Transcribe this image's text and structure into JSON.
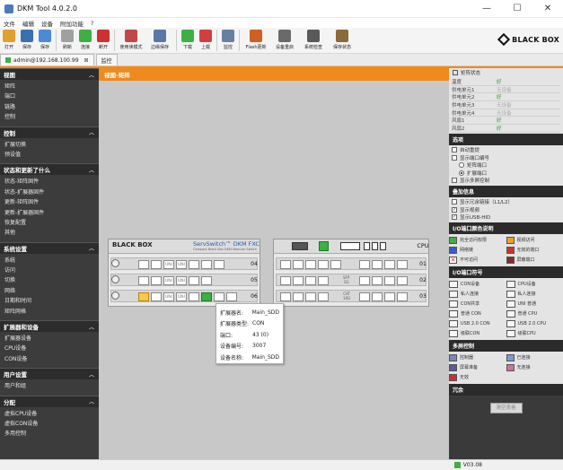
{
  "window": {
    "title": "DKM Tool 4.0.2.0",
    "minimize": "—",
    "maximize": "☐",
    "close": "✕"
  },
  "menu": [
    "文件",
    "编辑",
    "设备",
    "附加功能",
    "?"
  ],
  "toolbar": [
    {
      "label": "打开",
      "color": "#e0a030"
    },
    {
      "label": "保存",
      "color": "#3a6fb0"
    },
    {
      "label": "保存",
      "color": "#4a8ad8"
    },
    {
      "label": "刷新",
      "color": "#a0a0a0"
    },
    {
      "label": "连接",
      "color": "#3cb043"
    },
    {
      "label": "断开",
      "color": "#d03030"
    },
    {
      "label": "使用读模式",
      "color": "#c04848"
    },
    {
      "label": "边缘保存",
      "color": "#5878a8"
    },
    {
      "label": "下载",
      "color": "#3cb043"
    },
    {
      "label": "上载",
      "color": "#d04040"
    },
    {
      "label": "监控",
      "color": "#6880a0"
    },
    {
      "label": "Flash更新",
      "color": "#d06020"
    },
    {
      "label": "设备重启",
      "color": "#6a6a6a"
    },
    {
      "label": "系统检查",
      "color": "#5a5a5a"
    },
    {
      "label": "保存状态",
      "color": "#8a6a3a"
    }
  ],
  "brand": "BLACK BOX",
  "tabs": [
    {
      "label": "admin@192.168.100.99",
      "close": "⊠"
    },
    {
      "label": "监控"
    }
  ],
  "sidebar": {
    "sections": [
      {
        "title": "视图",
        "items": [
          "矩阵",
          "端口",
          "链路",
          "控制"
        ]
      },
      {
        "title": "控制",
        "items": [
          "扩展切换",
          "预设值"
        ]
      },
      {
        "title": "状态和更新了什么",
        "items": [
          "状态-矩阵固件",
          "状态-扩展器固件",
          "更新-矩阵固件",
          "更新-扩展器固件",
          "恢复配置",
          "其他"
        ]
      },
      {
        "title": "系统设置",
        "items": [
          "系统",
          "访问",
          "切换",
          "网络",
          "日期和时间",
          "矩阵网格"
        ]
      },
      {
        "title": "扩展器和设备",
        "items": [
          "扩展器设备",
          "CPU设备",
          "CON设备"
        ]
      },
      {
        "title": "用户设置",
        "items": [
          "用户和组"
        ]
      },
      {
        "title": "分配",
        "items": [
          "虚拟CPU设备",
          "虚拟CON设备",
          "多用控制"
        ]
      }
    ]
  },
  "main": {
    "header": "视图-矩阵"
  },
  "device": {
    "left_brand": "BLACK BOX",
    "left_model": "ServSwitch™ DKM FXC",
    "left_sub": "Compact Black Box DKM Modular Switch",
    "slots": {
      "unit": "UNI",
      "lan": "LAN"
    },
    "ports_mid": [
      "04",
      "05",
      "06"
    ],
    "ports_right": [
      "01",
      "02",
      "03"
    ],
    "cpu_label": "CPU",
    "sfp_label": "SFP",
    "cat_label": "CAT",
    "one_g": "1G",
    "ten_g": "10G"
  },
  "tooltip": [
    {
      "k": "扩展器名:",
      "v": "Main_SDD"
    },
    {
      "k": "扩展器类型:",
      "v": "CON"
    },
    {
      "k": "端口:",
      "v": "43 (0)"
    },
    {
      "k": "设备编号:",
      "v": "3007"
    },
    {
      "k": "设备名称:",
      "v": "Main_SDD"
    }
  ],
  "right": {
    "status_title": "矩阵状态",
    "status_rows": [
      {
        "k": "温度",
        "v": "好"
      },
      {
        "k": "供电单元1",
        "v": "无设备"
      },
      {
        "k": "供电单元2",
        "v": "好"
      },
      {
        "k": "供电单元3",
        "v": "无设备"
      },
      {
        "k": "供电单元4",
        "v": "无设备"
      },
      {
        "k": "风扇1",
        "v": "好"
      },
      {
        "k": "风扇2",
        "v": "好"
      }
    ],
    "options_title": "选项",
    "options": {
      "auto_refresh": "自动重提",
      "show_port_no": "显示端口编号",
      "radio_matrix": "矩阵端口",
      "radio_ext": "扩展端口",
      "show_multi": "显示多屏控制"
    },
    "display_title": "叠加信息",
    "display": {
      "a": "显示冗余链接（L1/L2）",
      "b": "显示视频",
      "c": "显示USB-HID"
    },
    "color_title": "I/O端口颜色说明",
    "colors": [
      {
        "label": "完全访问权限",
        "color": "#3cb043"
      },
      {
        "label": "视频访问",
        "color": "#f0a020"
      },
      {
        "label": "网络链",
        "color": "#3a5ad0"
      },
      {
        "label": "无效的端口",
        "color": "#d03030"
      },
      {
        "label": "不可访问",
        "color": "#ffffff"
      },
      {
        "label": "屏蔽端口",
        "color": "#8a2a2a"
      }
    ],
    "symbol_title": "I/O端口符号",
    "symbols": [
      {
        "label": "CON设备",
        "icon": "monitor-icon"
      },
      {
        "label": "CPU设备",
        "icon": "computer-icon"
      },
      {
        "label": "私人连接",
        "icon": "user-icon"
      },
      {
        "label": "私人连接",
        "icon": "user-icon"
      },
      {
        "label": "CON共享",
        "icon": "share-icon"
      },
      {
        "label": "UNI 普通",
        "icon": "uni-icon"
      },
      {
        "label": "普通 CON",
        "icon": "con-icon"
      },
      {
        "label": "普通 CPU",
        "icon": "cpu-icon"
      },
      {
        "label": "USB 2.0 CON",
        "icon": "usb-icon"
      },
      {
        "label": "USB 2.0 CPU",
        "icon": "usb-icon"
      },
      {
        "label": "级联CON",
        "icon": "cascade-icon"
      },
      {
        "label": "级联CPU",
        "icon": "cascade-icon"
      }
    ],
    "multi_title": "多屏控制",
    "multi": [
      {
        "label": "控制器",
        "color": "#7a86b8"
      },
      {
        "label": "已连接",
        "color": "#7a9ad8"
      },
      {
        "label": "屏幕准备",
        "color": "#5a5a9a"
      },
      {
        "label": "无连接",
        "color": "#d070a0"
      },
      {
        "label": "无效",
        "color": "#d03030"
      }
    ],
    "redundant_title": "冗余",
    "clear_btn": "清空表格"
  },
  "status": {
    "version": "V03.08"
  }
}
